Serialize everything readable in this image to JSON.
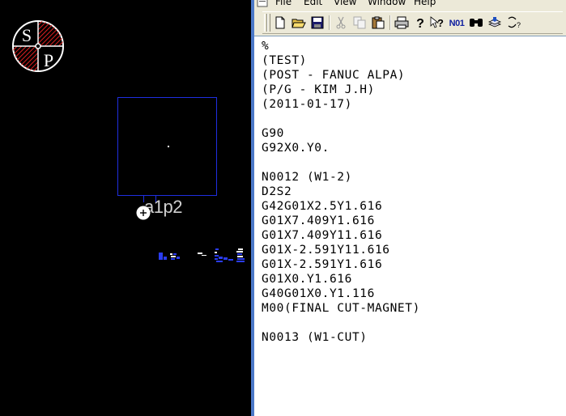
{
  "cad": {
    "logo": {
      "letter_top": "S",
      "letter_bottom": "P",
      "accent_color": "#e02020"
    },
    "shape_label": "a1p2"
  },
  "editor": {
    "menu": [
      {
        "label": "File"
      },
      {
        "label": "Edit"
      },
      {
        "label": "View"
      },
      {
        "label": "Window"
      },
      {
        "label": "Help"
      }
    ],
    "toolbar": {
      "icons": [
        "new-file-icon",
        "open-folder-icon",
        "save-icon",
        "cut-icon",
        "copy-icon",
        "paste-icon",
        "print-icon",
        "help-icon",
        "context-help-icon",
        "n01-icon",
        "find-icon",
        "stack-icon",
        "replace-icon"
      ],
      "n01_label": "N01"
    },
    "code_lines": [
      "%",
      "(TEST)",
      "(POST - FANUC ALPA)",
      "(P/G - KIM J.H)",
      "(2011-01-17)",
      "",
      "G90",
      "G92X0.Y0.",
      "",
      "N0012 (W1-2)",
      "D2S2",
      "G42G01X2.5Y1.616",
      "G01X7.409Y1.616",
      "G01X7.409Y11.616",
      "G01X-2.591Y11.616",
      "G01X-2.591Y1.616",
      "G01X0.Y1.616",
      "G40G01X0.Y1.116",
      "M00(FINAL CUT-MAGNET)",
      "",
      "N0013 (W1-CUT)"
    ]
  }
}
